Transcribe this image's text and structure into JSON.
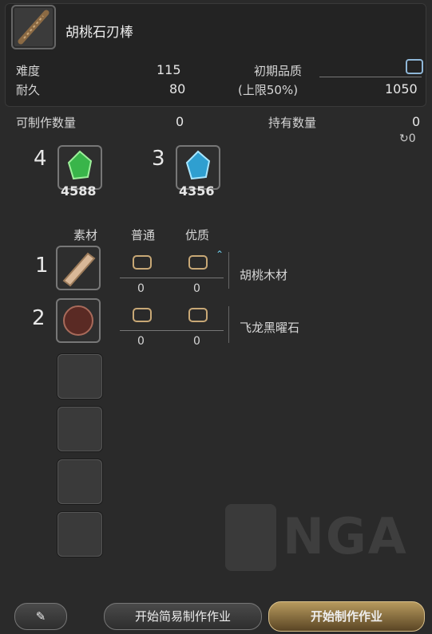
{
  "item": {
    "name": "胡桃石刃棒"
  },
  "stats": {
    "difficulty_label": "难度",
    "difficulty": "115",
    "durability_label": "耐久",
    "durability": "80",
    "quality_label": "初期品质",
    "quality_cap_label": "(上限50%)",
    "quality_max": "1050"
  },
  "counts": {
    "craftable_label": "可制作数量",
    "craftable": "0",
    "owned_label": "持有数量",
    "owned": "0",
    "owned_hq": "0"
  },
  "crystals": [
    {
      "required": "4",
      "have": "4588",
      "kind": "wind-crystal-icon"
    },
    {
      "required": "3",
      "have": "4356",
      "kind": "water-crystal-icon"
    }
  ],
  "materials_header": {
    "material": "素材",
    "normal": "普通",
    "hq": "优质"
  },
  "materials": [
    {
      "index": "1",
      "name": "胡桃木材",
      "normal": "0",
      "hq": "0"
    },
    {
      "index": "2",
      "name": "飞龙黑曜石",
      "normal": "0",
      "hq": "0"
    }
  ],
  "watermark": "NGA",
  "buttons": {
    "quick_synth": "开始简易制作作业",
    "synthesize": "开始制作作业"
  },
  "colors": {
    "accent": "#c8a876",
    "quality_box": "#8fb7d8",
    "hq_arrow": "#6fd0f0"
  }
}
